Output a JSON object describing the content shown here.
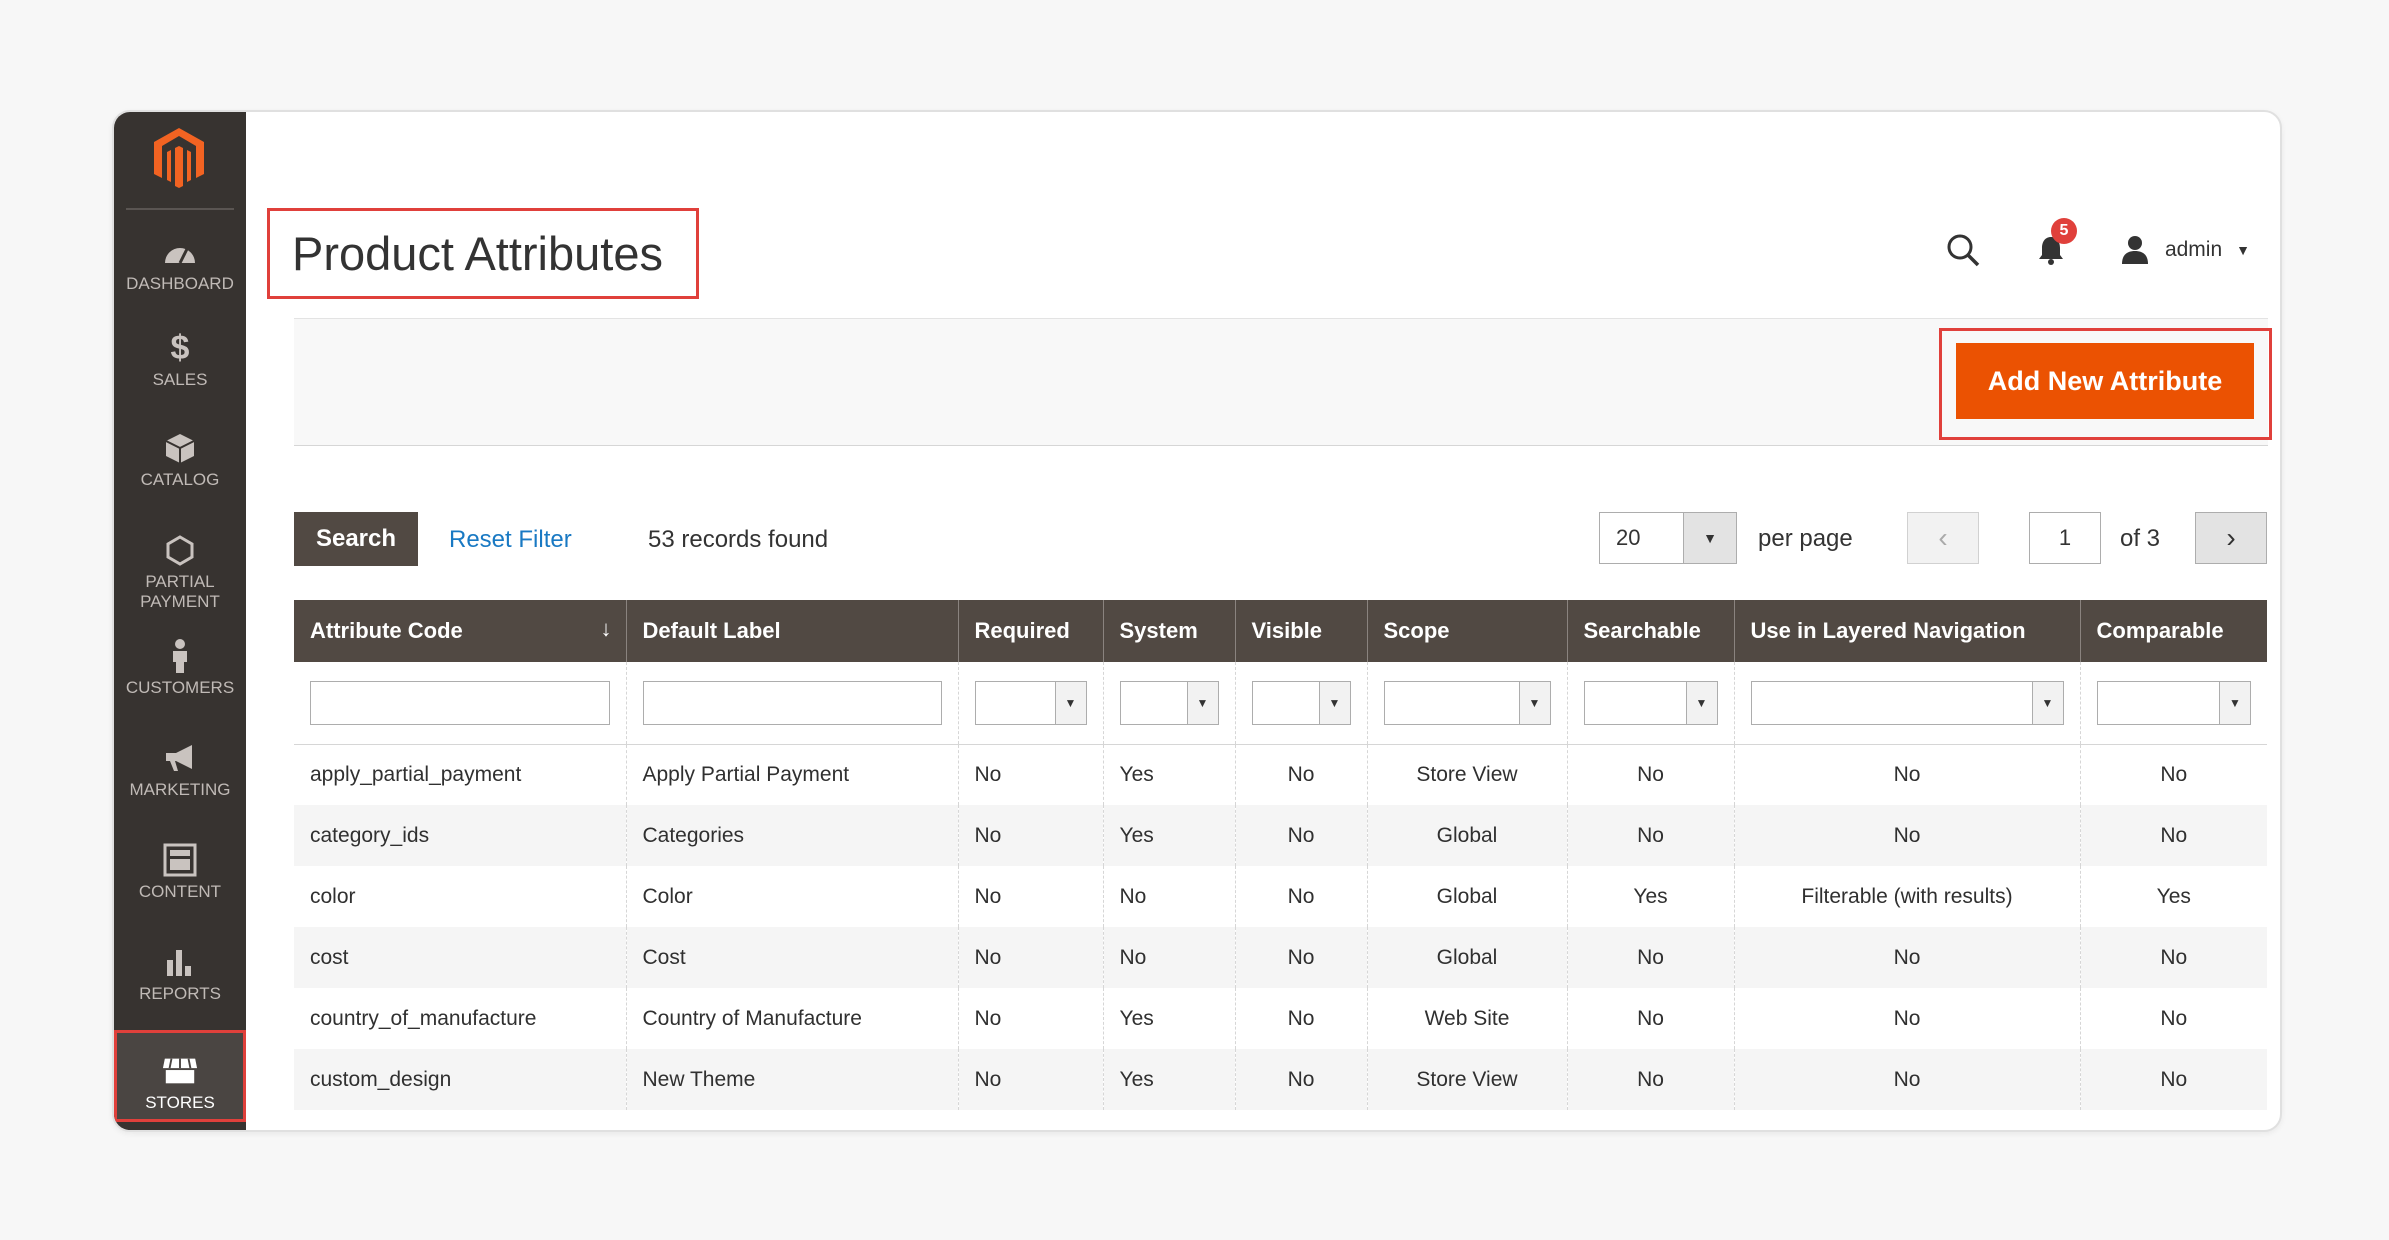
{
  "sidebar": {
    "items": [
      {
        "label": "DASHBOARD",
        "icon": "dashboard-icon"
      },
      {
        "label": "SALES",
        "icon": "dollar-icon"
      },
      {
        "label": "CATALOG",
        "icon": "box-icon"
      },
      {
        "label": "PARTIAL\nPAYMENT",
        "icon": "hexagon-icon"
      },
      {
        "label": "CUSTOMERS",
        "icon": "person-icon"
      },
      {
        "label": "MARKETING",
        "icon": "megaphone-icon"
      },
      {
        "label": "CONTENT",
        "icon": "layout-icon"
      },
      {
        "label": "REPORTS",
        "icon": "bar-chart-icon"
      },
      {
        "label": "STORES",
        "icon": "store-icon"
      }
    ]
  },
  "header": {
    "title": "Product Attributes",
    "notifications_count": "5",
    "user": "admin"
  },
  "actions": {
    "add_label": "Add New Attribute"
  },
  "toolbar": {
    "search_label": "Search",
    "reset_label": "Reset Filter",
    "records": "53 records found",
    "per_page_value": "20",
    "per_page_label": "per page",
    "page": "1",
    "of_pages": "of 3"
  },
  "grid": {
    "columns": [
      "Attribute Code",
      "Default Label",
      "Required",
      "System",
      "Visible",
      "Scope",
      "Searchable",
      "Use in Layered Navigation",
      "Comparable"
    ],
    "rows": [
      [
        "apply_partial_payment",
        "Apply Partial Payment",
        "No",
        "Yes",
        "No",
        "Store View",
        "No",
        "No",
        "No"
      ],
      [
        "category_ids",
        "Categories",
        "No",
        "Yes",
        "No",
        "Global",
        "No",
        "No",
        "No"
      ],
      [
        "color",
        "Color",
        "No",
        "No",
        "No",
        "Global",
        "Yes",
        "Filterable (with results)",
        "Yes"
      ],
      [
        "cost",
        "Cost",
        "No",
        "No",
        "No",
        "Global",
        "No",
        "No",
        "No"
      ],
      [
        "country_of_manufacture",
        "Country of Manufacture",
        "No",
        "Yes",
        "No",
        "Web Site",
        "No",
        "No",
        "No"
      ],
      [
        "custom_design",
        "New Theme",
        "No",
        "Yes",
        "No",
        "Store View",
        "No",
        "No",
        "No"
      ]
    ]
  },
  "colors": {
    "accent": "#eb5202",
    "highlight": "#e0403b",
    "sidebar": "#373330",
    "header_bg": "#514943",
    "link": "#1979c3"
  }
}
